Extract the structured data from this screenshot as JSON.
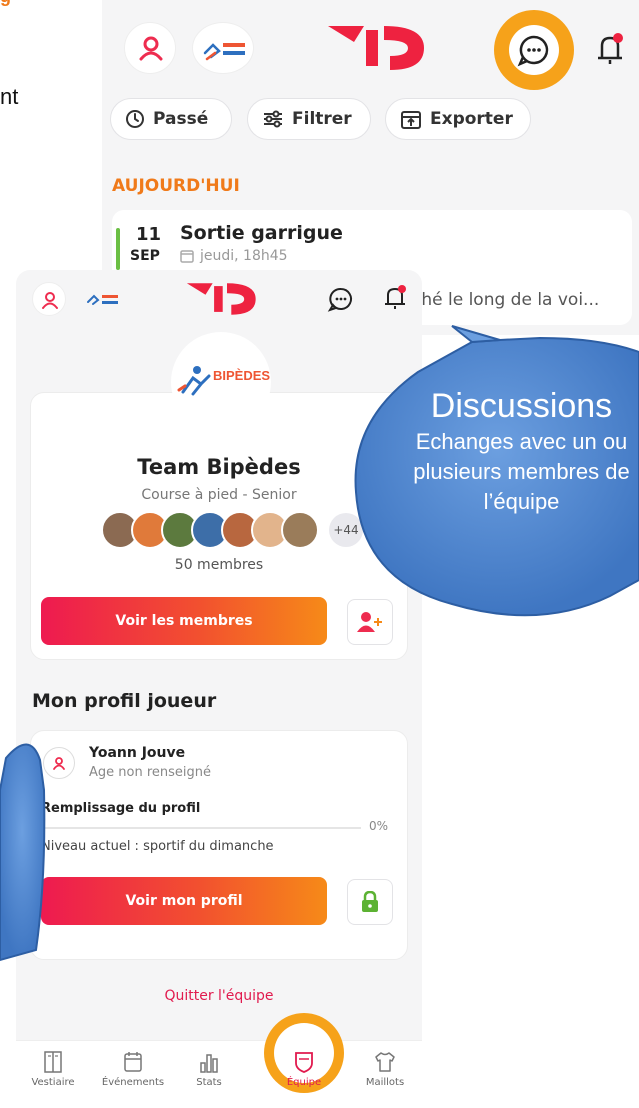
{
  "back_screen": {
    "buttons": {
      "past": "Passé",
      "filter": "Filtrer",
      "export": "Exporter"
    },
    "section_title": "AUJOURD'HUI",
    "event": {
      "day": "11",
      "month": "SEP",
      "title": "Sortie garrigue",
      "date": "jeudi, 18h45",
      "snippet": "ché le long de la voi..."
    }
  },
  "front_screen": {
    "team": {
      "logo_text": "BIPÈDES VAUNAGE",
      "name": "Team Bipèdes",
      "subtitle": "Course à pied - Senior",
      "extra_count": "+44",
      "members_count": "50 membres",
      "members_button": "Voir les membres"
    },
    "profile": {
      "heading": "Mon profil joueur",
      "name": "Yoann Jouve",
      "age": "Age non renseigné",
      "fill_label": "Remplissage du profil",
      "fill_value": "0%",
      "fill_fraction": 0,
      "level": "Niveau actuel : sportif du dimanche",
      "profile_button": "Voir mon profil"
    },
    "leave_label": "Quitter l'équipe",
    "tabs": [
      {
        "label": "Vestiaire",
        "icon": "locker-icon"
      },
      {
        "label": "Événements",
        "icon": "calendar-icon"
      },
      {
        "label": "Stats",
        "icon": "stats-icon"
      },
      {
        "label": "Équipe",
        "icon": "shield-icon",
        "active": true
      },
      {
        "label": "Maillots",
        "icon": "jersey-icon"
      }
    ]
  },
  "callout": {
    "title": "Discussions",
    "body": "Echanges avec un ou plusieurs membres de l’équipe"
  },
  "colors": {
    "accent_orange": "#f6a21a",
    "brand_red": "#e11a4e",
    "gradient_start": "#ee1a50",
    "gradient_end": "#f68a18",
    "callout_blue": "#4f86cc"
  }
}
